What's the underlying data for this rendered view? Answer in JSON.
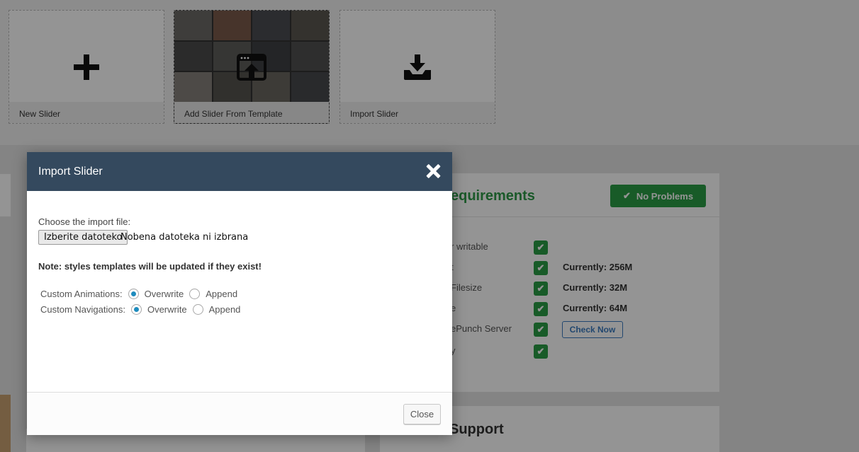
{
  "tiles": [
    {
      "label": "New Slider",
      "icon": "plus-icon"
    },
    {
      "label": "Add Slider From Template",
      "icon": "upload-window-icon"
    },
    {
      "label": "Import Slider",
      "icon": "download-tray-icon"
    }
  ],
  "requirements": {
    "title": "equirements",
    "status_label": "No Problems",
    "rows": [
      {
        "label": "r writable",
        "value": ""
      },
      {
        "label": "t",
        "value": "Currently: 256M"
      },
      {
        "label": "Filesize",
        "value": "Currently: 32M"
      },
      {
        "label": "e",
        "value": "Currently: 64M"
      },
      {
        "label": "ePunch Server",
        "value": ""
      },
      {
        "label": "y",
        "value": ""
      }
    ],
    "check_now_label": "Check Now"
  },
  "support": {
    "title": "Support"
  },
  "modal": {
    "title": "Import Slider",
    "choose_label": "Choose the import file:",
    "file_button_label": "Izberite datoteko",
    "file_status": "Nobena datoteka ni izbrana",
    "note": "Note: styles templates will be updated if they exist!",
    "options": [
      {
        "label": "Custom Animations:",
        "choices": [
          "Overwrite",
          "Append"
        ],
        "selected": "Overwrite"
      },
      {
        "label": "Custom Navigations:",
        "choices": [
          "Overwrite",
          "Append"
        ],
        "selected": "Overwrite"
      }
    ],
    "close_label": "Close"
  },
  "colors": {
    "modal_header": "#34495e",
    "success": "#2a9e46",
    "link": "#3b7bbf",
    "radio_selected": "#1e8cbe"
  }
}
